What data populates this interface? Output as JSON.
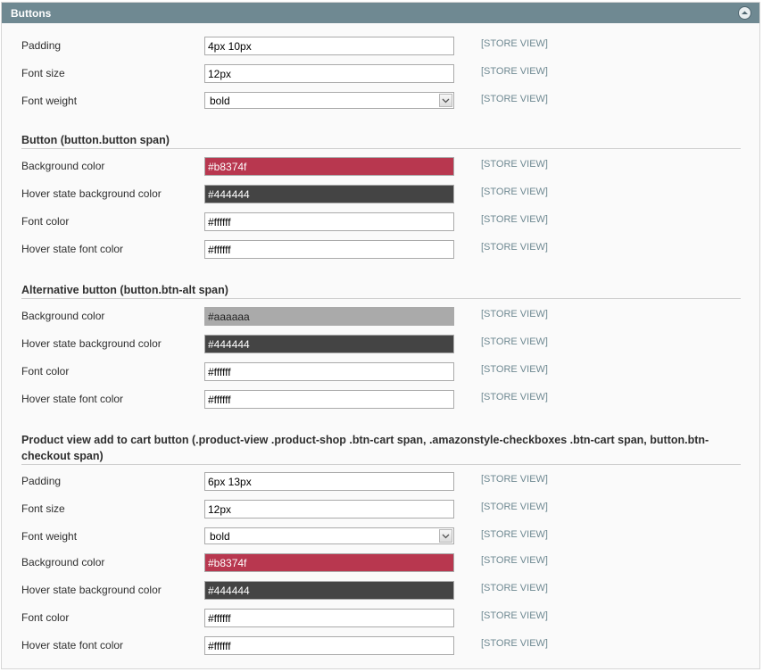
{
  "header": {
    "title": "Buttons",
    "collapse_icon": "collapse-up-icon"
  },
  "scope_label": "[STORE VIEW]",
  "general": {
    "padding": {
      "label": "Padding",
      "value": "4px 10px"
    },
    "font_size": {
      "label": "Font size",
      "value": "12px"
    },
    "font_weight": {
      "label": "Font weight",
      "value": "bold"
    }
  },
  "button": {
    "title": "Button (button.button span)",
    "bg": {
      "label": "Background color",
      "value": "#b8374f",
      "color": "#b8374f"
    },
    "hover_bg": {
      "label": "Hover state background color",
      "value": "#444444",
      "color": "#444444"
    },
    "font_color": {
      "label": "Font color",
      "value": "#ffffff"
    },
    "hover_font": {
      "label": "Hover state font color",
      "value": "#ffffff"
    }
  },
  "alt_button": {
    "title": "Alternative button (button.btn-alt span)",
    "bg": {
      "label": "Background color",
      "value": "#aaaaaa",
      "color": "#aaaaaa"
    },
    "hover_bg": {
      "label": "Hover state background color",
      "value": "#444444",
      "color": "#444444"
    },
    "font_color": {
      "label": "Font color",
      "value": "#ffffff"
    },
    "hover_font": {
      "label": "Hover state font color",
      "value": "#ffffff"
    }
  },
  "cart_button": {
    "title": "Product view add to cart button (.product-view .product-shop .btn-cart span, .amazonstyle-checkboxes .btn-cart span, button.btn-checkout span)",
    "padding": {
      "label": "Padding",
      "value": "6px 13px"
    },
    "font_size": {
      "label": "Font size",
      "value": "12px"
    },
    "font_weight": {
      "label": "Font weight",
      "value": "bold"
    },
    "bg": {
      "label": "Background color",
      "value": "#b8374f",
      "color": "#b8374f"
    },
    "hover_bg": {
      "label": "Hover state background color",
      "value": "#444444",
      "color": "#444444"
    },
    "font_color": {
      "label": "Font color",
      "value": "#ffffff"
    },
    "hover_font": {
      "label": "Hover state font color",
      "value": "#ffffff"
    }
  }
}
